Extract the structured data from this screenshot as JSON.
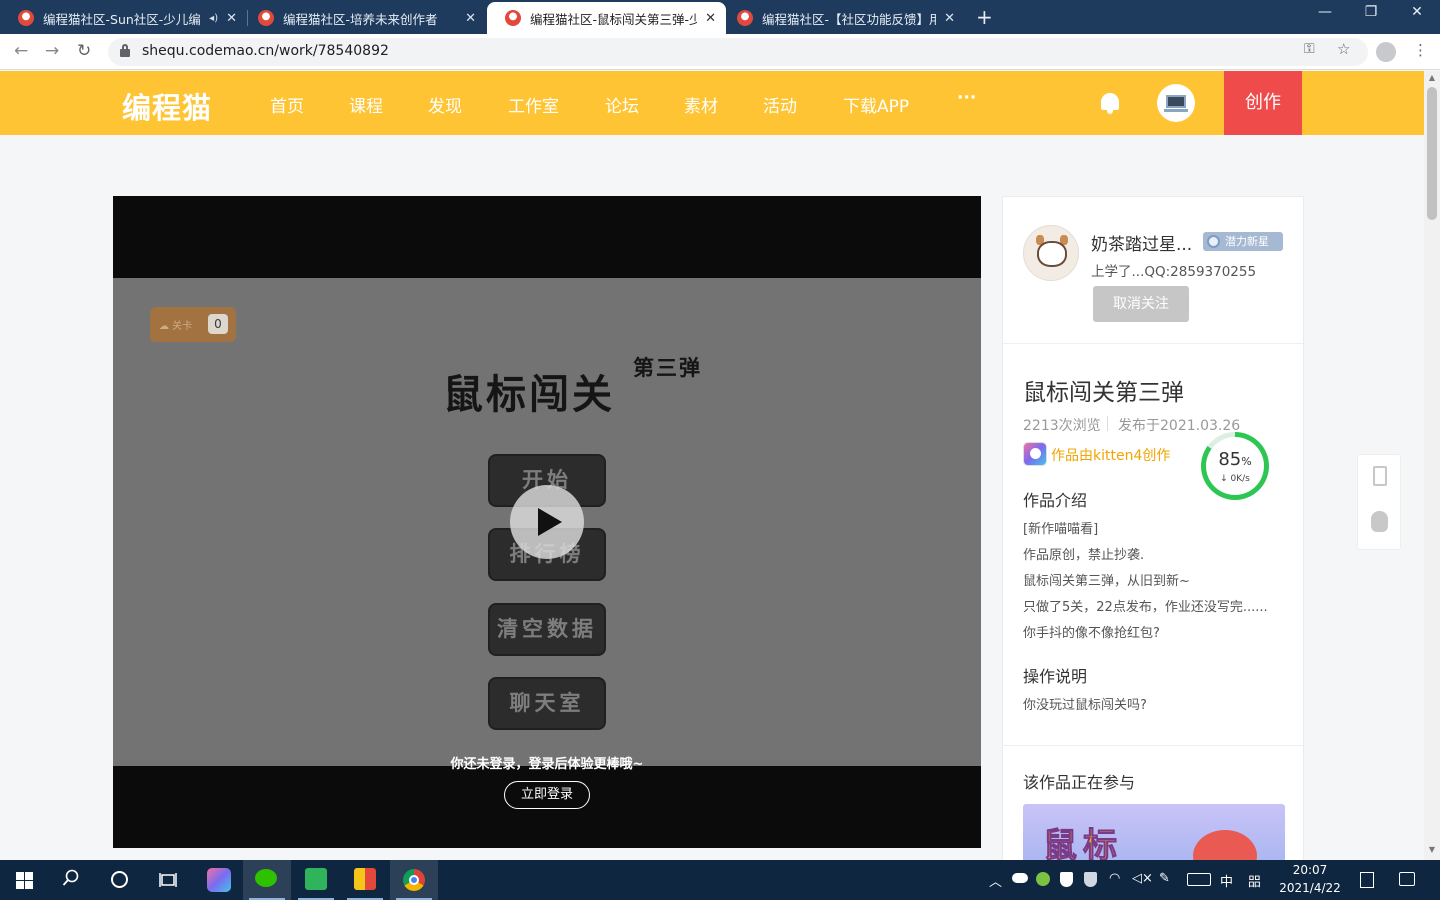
{
  "browser": {
    "tabs": [
      {
        "title": "编程猫社区-Sun社区-少儿编",
        "audio": "◂)",
        "close": "✕"
      },
      {
        "title": "编程猫社区-培养未来创作者",
        "close": "✕"
      },
      {
        "title": "编程猫社区-鼠标闯关第三弹-少儿",
        "close": "✕"
      },
      {
        "title": "编程猫社区-【社区功能反馈】用",
        "close": "✕"
      }
    ],
    "new_tab": "+",
    "window_controls": {
      "minimize": "—",
      "maximize": "❐",
      "close": "✕"
    },
    "nav": {
      "back": "←",
      "forward": "→",
      "reload": "↻"
    },
    "url": "shequ.codemao.cn/work/78540892",
    "toolbar_icons": {
      "key": "key-icon",
      "star": "☆",
      "menu": "⋮"
    }
  },
  "site": {
    "logo": "编程猫",
    "nav": [
      "首页",
      "课程",
      "发现",
      "工作室",
      "论坛",
      "素材",
      "活动",
      "下载APP",
      "···"
    ],
    "create": "创作",
    "accent": "#fec433",
    "create_color": "#ef4b4b"
  },
  "player": {
    "level_label": "☁ 关卡",
    "level_value": "0",
    "game_title": "鼠标闯关",
    "game_subtitle": "第三弹",
    "buttons": [
      "开始",
      "排行榜",
      "清空数据",
      "聊天室"
    ],
    "login_tip": "你还未登录，登录后体验更棒哦~",
    "login_button": "立即登录"
  },
  "author": {
    "name": "奶茶踏过星...",
    "badge": "潜力新星",
    "bio": "上学了...QQ:2859370255",
    "unfollow": "取消关注"
  },
  "work": {
    "title": "鼠标闯关第三弹",
    "views": "2213次浏览",
    "published": "发布于2021.03.26",
    "made_with": "作品由kitten4创作",
    "intro_title": "作品介绍",
    "intro_lines": [
      "[新作喵喵看]",
      "作品原创，禁止抄袭.",
      "鼠标闯关第三弹，从旧到新~",
      "只做了5关，22点发布，作业还没写完......",
      "你手抖的像不像抢红包?"
    ],
    "howto_title": "操作说明",
    "howto_text": "你没玩过鼠标闯关吗?",
    "participating_title": "该作品正在参与",
    "banner_text": "鼠标"
  },
  "gauge": {
    "percent": "85",
    "percent_unit": "%",
    "rate": "↓ 0K/s",
    "value": 0.85
  },
  "taskbar": {
    "time": "20:07",
    "date": "2021/4/22",
    "ime": "中",
    "ime_mode": "㗊"
  }
}
